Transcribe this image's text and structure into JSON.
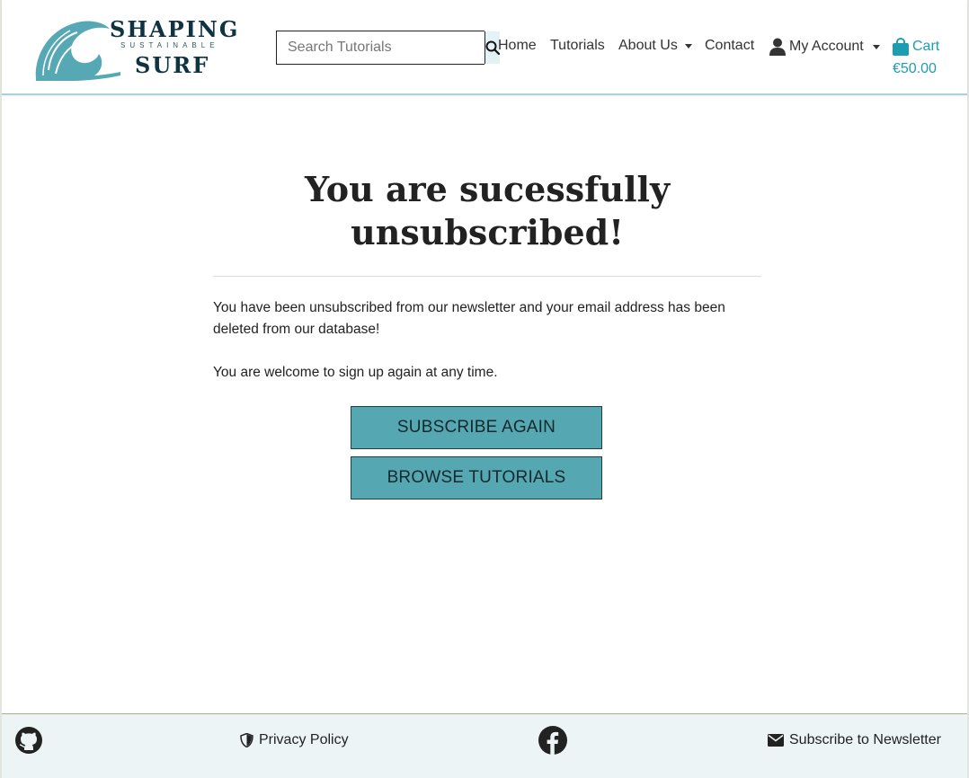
{
  "brand": {
    "line1": "SHAPING",
    "line2": "SUSTAINABLE",
    "line3": "SURF",
    "icon": "wave-logo",
    "color": "#56a9b4"
  },
  "search": {
    "placeholder": "Search Tutorials",
    "icon": "search-icon"
  },
  "nav": {
    "home": "Home",
    "tutorials": "Tutorials",
    "about": "About Us",
    "contact": "Contact",
    "account": "My Account",
    "cart_label": "Cart",
    "cart_total": "€50.00"
  },
  "main": {
    "title_line1": "You are sucessfully",
    "title_line2": "unsubscribed!",
    "paragraph1": "You have been unsubscribed from our newsletter and your email address has been deleted from our database!",
    "paragraph2": "You are welcome to sign up again at any time.",
    "subscribe_button": "SUBSCRIBE AGAIN",
    "browse_button": "BROWSE TUTORIALS"
  },
  "footer": {
    "privacy": "Privacy Policy",
    "newsletter": "Subscribe to Newsletter"
  },
  "colors": {
    "accent": "#1e9db0",
    "button": "#55a7b2",
    "footer_bg": "#ecf4f6"
  }
}
